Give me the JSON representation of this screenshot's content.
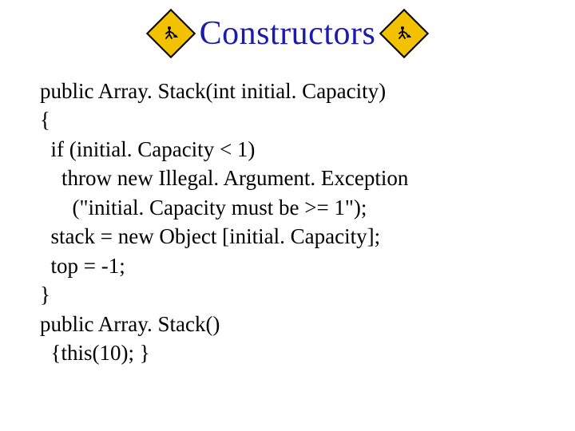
{
  "title": "Constructors",
  "icons": {
    "left": "construction-sign",
    "right": "construction-sign"
  },
  "code": {
    "l1": "public Array. Stack(int initial. Capacity)",
    "l2": "{",
    "l3": "  if (initial. Capacity < 1)",
    "l4": "    throw new Illegal. Argument. Exception",
    "l5": "      (\"initial. Capacity must be >= 1\");",
    "l6": "  stack = new Object [initial. Capacity];",
    "l7": "  top = -1;",
    "l8": "}",
    "l9": "public Array. Stack()",
    "l10": "  {this(10); }"
  }
}
